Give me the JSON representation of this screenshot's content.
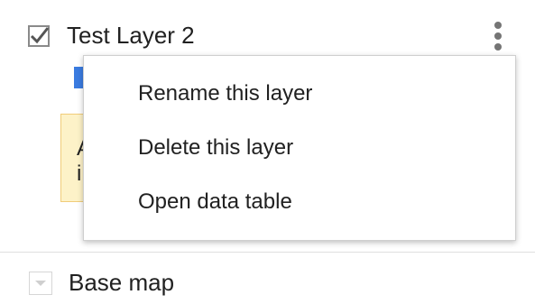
{
  "layer": {
    "title": "Test Layer 2",
    "visible": true,
    "check_icon": "checkbox-checked-icon",
    "more_icon": "more-vert-icon",
    "notice_text": "A\ni"
  },
  "context_menu": {
    "items": [
      {
        "label": "Rename this layer"
      },
      {
        "label": "Delete this layer"
      },
      {
        "label": "Open data table"
      }
    ]
  },
  "base_map": {
    "label": "Base map",
    "toggle_icon": "chevron-down-icon"
  },
  "colors": {
    "accent_blue": "#3a7be0",
    "notice_bg": "#fdf2c8",
    "notice_border": "#f0cc7a",
    "text": "#212121",
    "icon_grey": "#757575"
  }
}
